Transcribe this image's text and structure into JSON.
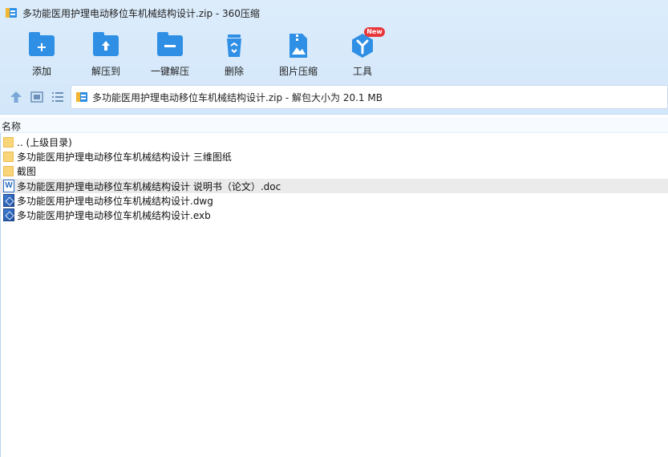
{
  "window": {
    "title": "多功能医用护理电动移位车机械结构设计.zip - 360压缩"
  },
  "toolbar": {
    "items": [
      {
        "label": "添加",
        "icon": "add-icon"
      },
      {
        "label": "解压到",
        "icon": "extract-to-icon"
      },
      {
        "label": "一键解压",
        "icon": "one-click-extract-icon"
      },
      {
        "label": "删除",
        "icon": "delete-icon"
      },
      {
        "label": "图片压缩",
        "icon": "image-compress-icon"
      },
      {
        "label": "工具",
        "icon": "tools-icon"
      }
    ],
    "new_badge": "New"
  },
  "address": {
    "text": "多功能医用护理电动移位车机械结构设计.zip - 解包大小为 20.1 MB"
  },
  "list": {
    "column_name": "名称",
    "rows": [
      {
        "name": ".. (上级目录)",
        "type": "folder"
      },
      {
        "name": "多功能医用护理电动移位车机械结构设计 三维图纸",
        "type": "folder"
      },
      {
        "name": "截图",
        "type": "folder"
      },
      {
        "name": "多功能医用护理电动移位车机械结构设计 说明书（论文）.doc",
        "type": "doc"
      },
      {
        "name": "多功能医用护理电动移位车机械结构设计.dwg",
        "type": "dwg"
      },
      {
        "name": "多功能医用护理电动移位车机械结构设计.exb",
        "type": "dwg"
      }
    ]
  },
  "colors": {
    "accent": "#2f8fe5",
    "folder": "#f9d57a",
    "badge": "#e8363a",
    "toolbar_bg": "#d3e7fa"
  }
}
